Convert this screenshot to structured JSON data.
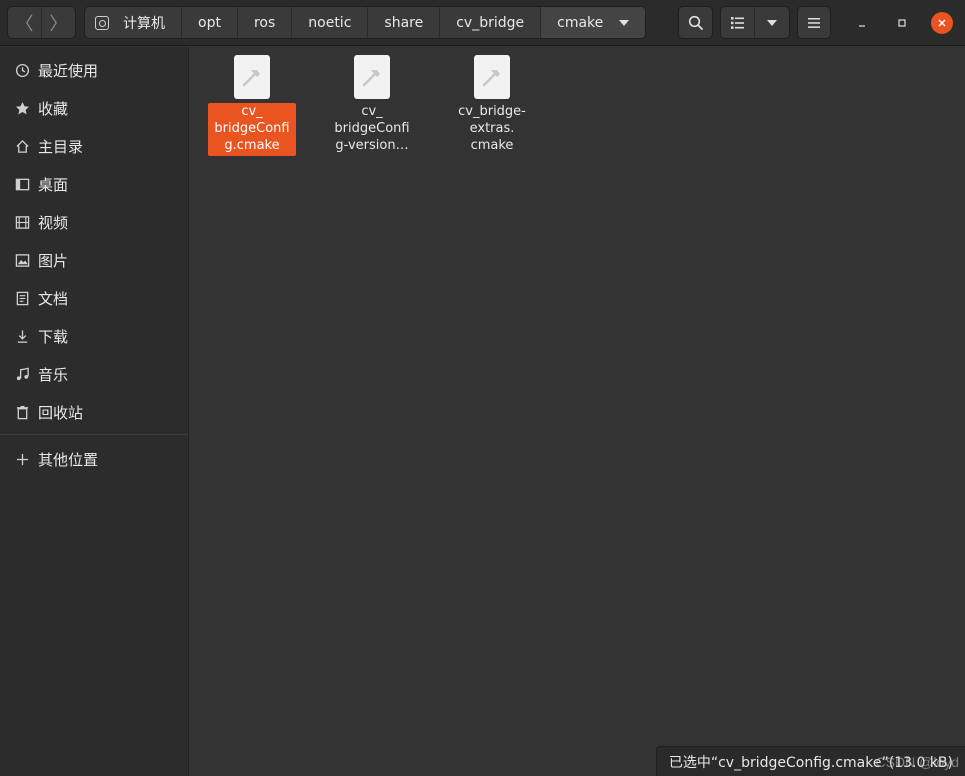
{
  "header": {
    "back_glyph": "〈",
    "forward_glyph": "〉",
    "breadcrumbs": [
      "计算机",
      "opt",
      "ros",
      "noetic",
      "share",
      "cv_bridge",
      "cmake"
    ]
  },
  "sidebar": {
    "items": [
      {
        "label": "最近使用",
        "icon": "clock-icon"
      },
      {
        "label": "收藏",
        "icon": "star-icon"
      },
      {
        "label": "主目录",
        "icon": "home-icon"
      },
      {
        "label": "桌面",
        "icon": "desktop-icon"
      },
      {
        "label": "视频",
        "icon": "video-icon"
      },
      {
        "label": "图片",
        "icon": "picture-icon"
      },
      {
        "label": "文档",
        "icon": "document-icon"
      },
      {
        "label": "下载",
        "icon": "download-icon"
      },
      {
        "label": "音乐",
        "icon": "music-icon"
      },
      {
        "label": "回收站",
        "icon": "trash-icon"
      }
    ],
    "other_locations": {
      "label": "其他位置",
      "icon": "plus-icon"
    }
  },
  "files": [
    {
      "name": "cv_\nbridgeConfi\ng.cmake",
      "selected": true
    },
    {
      "name": "cv_\nbridgeConfi\ng-version…",
      "selected": false
    },
    {
      "name": "cv_bridge-\nextras.\ncmake",
      "selected": false
    }
  ],
  "status": {
    "text": "已选中“cv_bridgeConfig.cmake”(13.0 kB)"
  },
  "watermark": "CSDN @loyd",
  "colors": {
    "accent": "#e95420",
    "background": "#333333",
    "sidebar": "#2c2c2c"
  }
}
